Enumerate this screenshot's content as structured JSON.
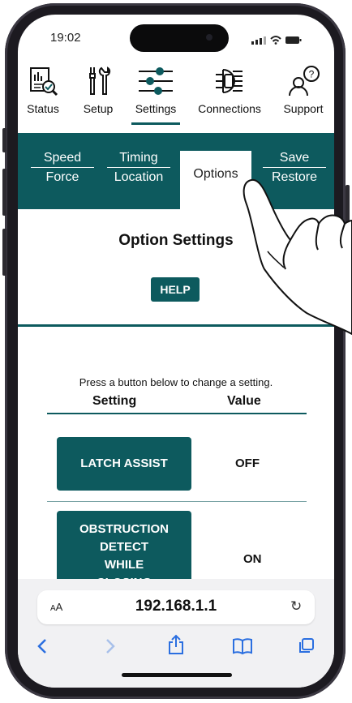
{
  "status_bar": {
    "time": "19:02"
  },
  "nav": {
    "items": [
      {
        "label": "Status",
        "icon": "report-search-icon"
      },
      {
        "label": "Setup",
        "icon": "tools-icon"
      },
      {
        "label": "Settings",
        "icon": "sliders-icon",
        "active": true
      },
      {
        "label": "Connections",
        "icon": "chip-icon"
      },
      {
        "label": "Support",
        "icon": "person-question-icon"
      }
    ]
  },
  "tabs": [
    {
      "line1": "Speed",
      "line2": "Force"
    },
    {
      "line1": "Timing",
      "line2": "Location"
    },
    {
      "label": "Options",
      "active": true
    },
    {
      "line1": "Save",
      "line2": "Restore"
    }
  ],
  "page": {
    "title": "Option Settings",
    "help_label": "HELP",
    "instruction": "Press a button below to change a setting.",
    "col_setting": "Setting",
    "col_value": "Value",
    "settings": [
      {
        "label": "LATCH ASSIST",
        "value": "OFF"
      },
      {
        "label_lines": [
          "OBSTRUCTION",
          "DETECT",
          "WHILE",
          "CLOSING"
        ],
        "value": "ON"
      }
    ]
  },
  "browser": {
    "aa": "AA",
    "url": "192.168.1.1",
    "toolbar": [
      "back",
      "forward",
      "share",
      "bookmarks",
      "tabs"
    ]
  },
  "colors": {
    "primary": "#0d5a5e",
    "link": "#2b6fe0"
  }
}
